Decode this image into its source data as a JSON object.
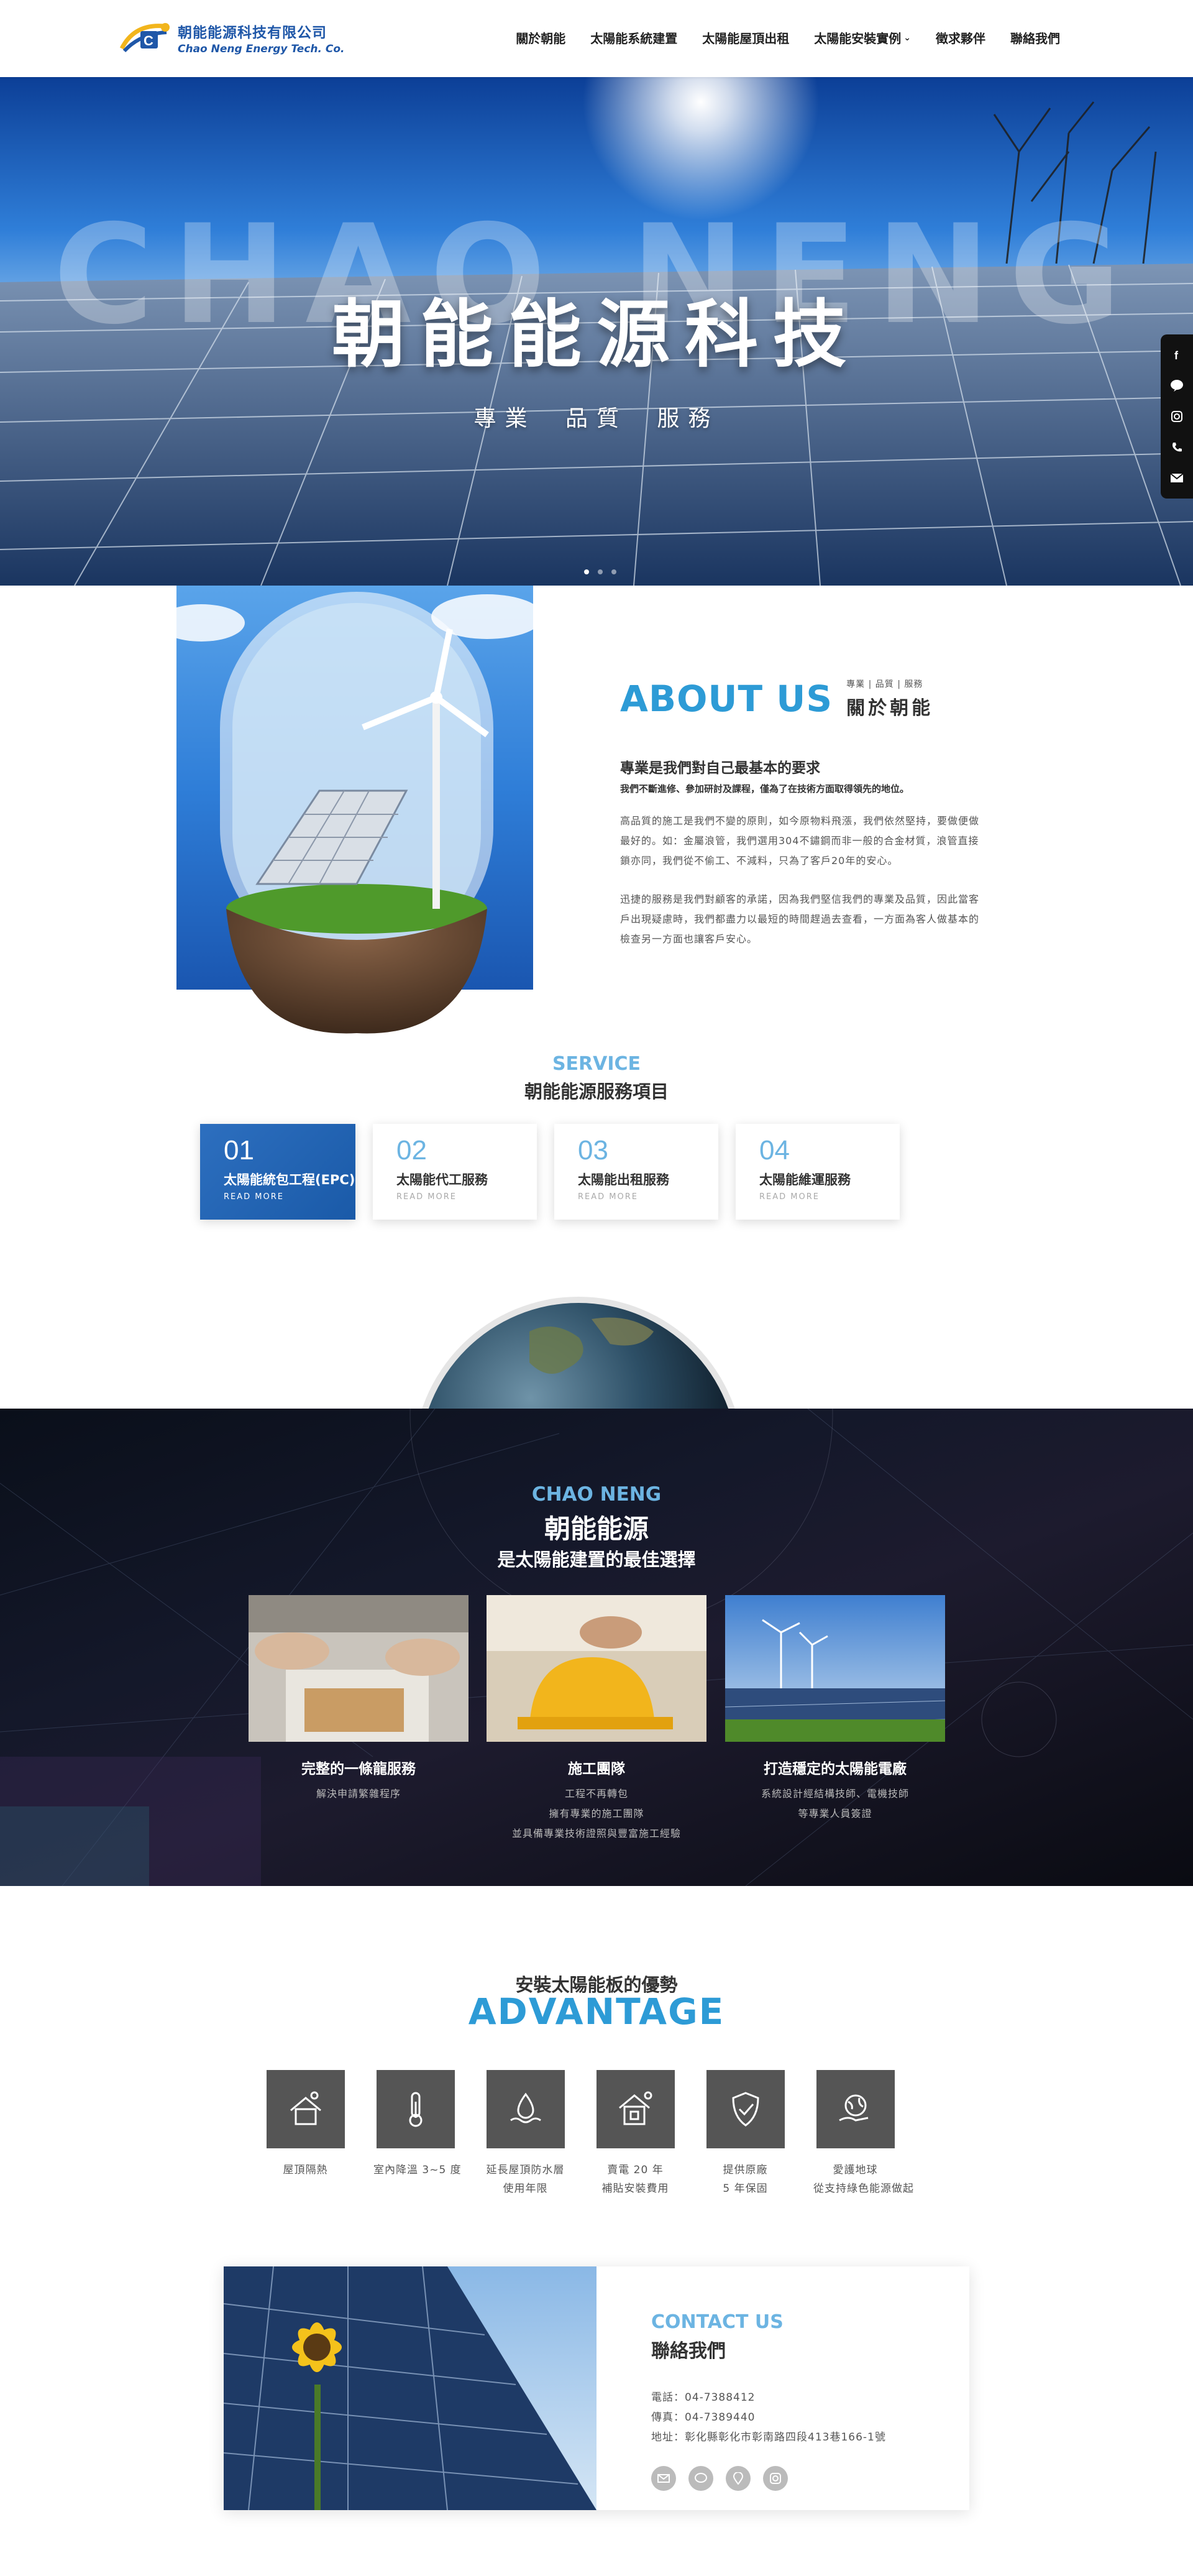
{
  "header": {
    "logo_zh": "朝能能源科技有限公司",
    "logo_en": "Chao Neng Energy Tech. Co.",
    "nav": [
      {
        "label": "關於朝能"
      },
      {
        "label": "太陽能系統建置"
      },
      {
        "label": "太陽能屋頂出租"
      },
      {
        "label": "太陽能安裝實例"
      },
      {
        "label": "徵求夥伴"
      },
      {
        "label": "聯絡我們"
      }
    ]
  },
  "hero": {
    "bg_word": "CHAO NENG",
    "title": "朝能能源科技",
    "subtitle": "專業 品質 服務"
  },
  "social": [
    "facebook-icon",
    "line-icon",
    "instagram-icon",
    "phone-icon",
    "mail-icon"
  ],
  "about": {
    "title_en": "ABOUT US",
    "tagline": "專業 | 品質 | 服務",
    "title_zh": "關於朝能",
    "heading": "專業是我們對自己最基本的要求",
    "subheading": "我們不斷進修、參加研討及課程，僅為了在技術方面取得領先的地位。",
    "para1": "高品質的施工是我們不變的原則，如今原物料飛漲，我們依然堅持，要做便做最好的。如：金屬浪管，我們選用304不鏽鋼而非一般的合金材質，浪管直接鎖亦同，我們從不偷工、不減料，只為了客戶20年的安心。",
    "para2": "迅捷的服務是我們對顧客的承諾，因為我們堅信我們的專業及品質，因此當客戶出現疑慮時，我們都盡力以最短的時間趕過去查看，一方面為客人做基本的檢查另一方面也讓客戶安心。"
  },
  "service": {
    "title_en": "SERVICE",
    "title_zh": "朝能能源服務項目",
    "cards": [
      {
        "num": "01",
        "title": "太陽能統包工程(EPC)",
        "more": "READ MORE"
      },
      {
        "num": "02",
        "title": "太陽能代工服務",
        "more": "READ MORE"
      },
      {
        "num": "03",
        "title": "太陽能出租服務",
        "more": "READ MORE"
      },
      {
        "num": "04",
        "title": "太陽能維運服務",
        "more": "READ MORE"
      }
    ]
  },
  "why": {
    "title_en": "CHAO NENG",
    "title_zh": "朝能能源",
    "subtitle": "是太陽能建置的最佳選擇",
    "features": [
      {
        "title": "完整的一條龍服務",
        "desc": [
          "解決申請繁雜程序"
        ]
      },
      {
        "title": "施工團隊",
        "desc": [
          "工程不再轉包",
          "擁有專業的施工團隊",
          "並具備專業技術證照與豐富施工經驗"
        ]
      },
      {
        "title": "打造穩定的太陽能電廠",
        "desc": [
          "系統設計經結構技師、電機技師",
          "等專業人員簽證"
        ]
      }
    ]
  },
  "advantage": {
    "title_zh": "安裝太陽能板的優勢",
    "title_en": "ADVANTAGE",
    "items": [
      {
        "icon": "house-sun-icon",
        "label": [
          "屋頂隔熱"
        ]
      },
      {
        "icon": "thermometer-icon",
        "label": [
          "室內降溫 3~5 度"
        ]
      },
      {
        "icon": "waterproof-icon",
        "label": [
          "延長屋頂防水層",
          "使用年限"
        ]
      },
      {
        "icon": "house-solar-icon",
        "label": [
          "賣電 20 年",
          "補貼安裝費用"
        ]
      },
      {
        "icon": "shield-icon",
        "label": [
          "提供原廠",
          "5 年保固"
        ]
      },
      {
        "icon": "earth-hand-icon",
        "label": [
          "愛護地球",
          "從支持綠色能源做起"
        ]
      }
    ]
  },
  "contact": {
    "title_en": "CONTACT US",
    "title_zh": "聯絡我們",
    "phone": "電話：04-7388412",
    "fax": "傳真：04-7389440",
    "address": "地址：彰化縣彰化市彰南路四段413巷166-1號",
    "icons": [
      "mail-icon",
      "line-icon",
      "location-icon",
      "instagram-icon"
    ]
  },
  "colors": {
    "accent": "#2d9bd6",
    "brand": "#1f57a8",
    "light_accent": "#6cb4e2"
  }
}
